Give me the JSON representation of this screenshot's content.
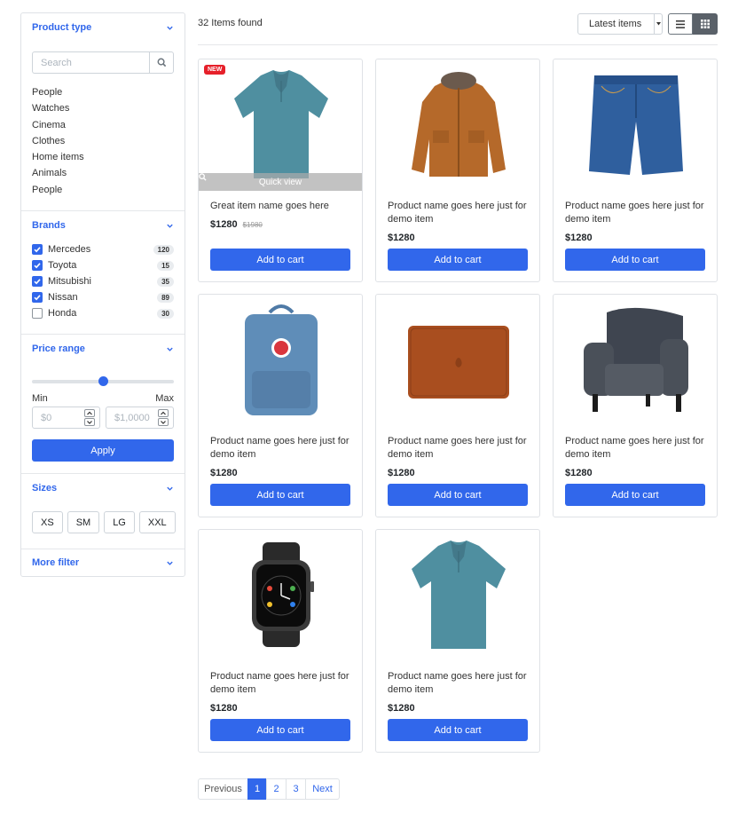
{
  "sidebar": {
    "product_type": {
      "title": "Product type",
      "search_placeholder": "Search",
      "items": [
        "People",
        "Watches",
        "Cinema",
        "Clothes",
        "Home items",
        "Animals",
        "People"
      ]
    },
    "brands": {
      "title": "Brands",
      "items": [
        {
          "label": "Mercedes",
          "count": "120",
          "checked": true
        },
        {
          "label": "Toyota",
          "count": "15",
          "checked": true
        },
        {
          "label": "Mitsubishi",
          "count": "35",
          "checked": true
        },
        {
          "label": "Nissan",
          "count": "89",
          "checked": true
        },
        {
          "label": "Honda",
          "count": "30",
          "checked": false
        }
      ]
    },
    "price_range": {
      "title": "Price range",
      "slider_value_fraction": 0.5,
      "min_label": "Min",
      "max_label": "Max",
      "min_placeholder": "$0",
      "max_placeholder": "$1,0000",
      "apply_label": "Apply"
    },
    "sizes": {
      "title": "Sizes",
      "options": [
        "XS",
        "SM",
        "LG",
        "XXL"
      ]
    },
    "more_filter": {
      "title": "More filter"
    }
  },
  "toolbar": {
    "items_found": "32 Items found",
    "sort_value": "Latest items",
    "view_mode": "grid"
  },
  "products": [
    {
      "title": "Great item name goes here",
      "price": "$1280",
      "old_price": "$1980",
      "badge": "NEW",
      "quick_view": "Quick view",
      "cart_label": "Add to cart",
      "image": "polo-shirt-icon"
    },
    {
      "title": "Product name goes here just for demo item",
      "price": "$1280",
      "cart_label": "Add to cart",
      "image": "jacket-icon"
    },
    {
      "title": "Product name goes here just for demo item",
      "price": "$1280",
      "cart_label": "Add to cart",
      "image": "denim-shorts-icon"
    },
    {
      "title": "Product name goes here just for demo item",
      "price": "$1280",
      "cart_label": "Add to cart",
      "image": "backpack-icon"
    },
    {
      "title": "Product name goes here just for demo item",
      "price": "$1280",
      "cart_label": "Add to cart",
      "image": "laptop-sleeve-icon"
    },
    {
      "title": "Product name goes here just for demo item",
      "price": "$1280",
      "cart_label": "Add to cart",
      "image": "armchair-icon"
    },
    {
      "title": "Product name goes here just for demo item",
      "price": "$1280",
      "cart_label": "Add to cart",
      "image": "smartwatch-icon"
    },
    {
      "title": "Product name goes here just for demo item",
      "price": "$1280",
      "cart_label": "Add to cart",
      "image": "polo-shirt-icon"
    }
  ],
  "pagination": {
    "previous": "Previous",
    "pages": [
      "1",
      "2",
      "3"
    ],
    "active_page": "1",
    "next": "Next"
  },
  "colors": {
    "accent": "#3167eb",
    "badge_red": "#e6202a",
    "border": "#dfe2e6",
    "view_toggle_active": "#5a6169"
  }
}
